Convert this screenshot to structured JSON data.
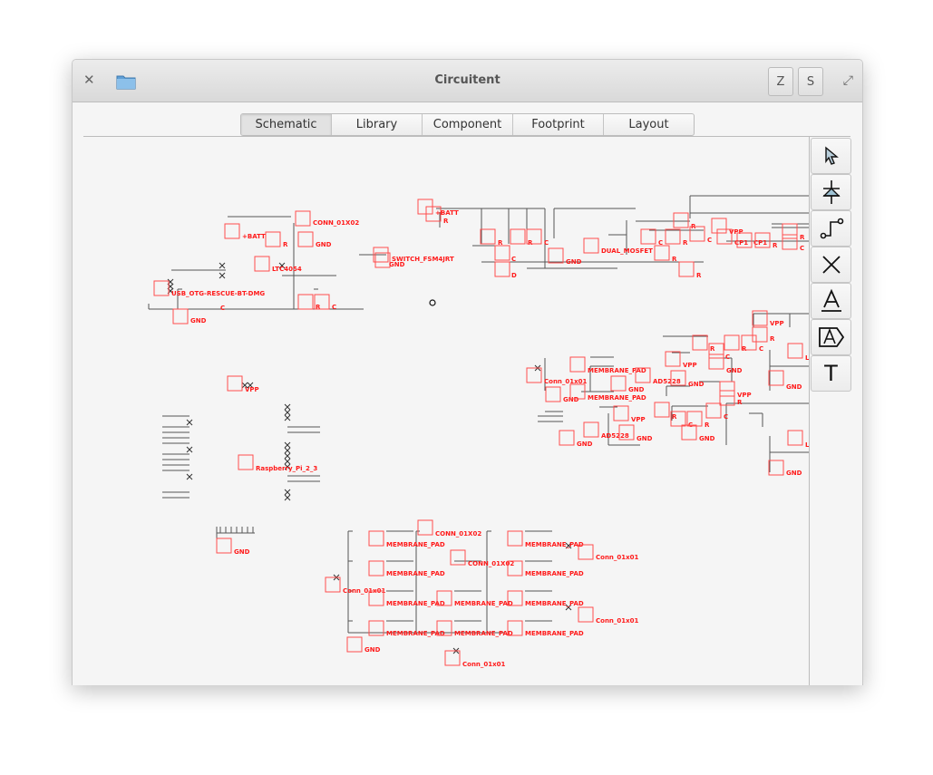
{
  "window": {
    "title": "Circuitent",
    "buttons": {
      "z": "Z",
      "s": "S"
    }
  },
  "tabs": [
    {
      "label": "Schematic",
      "active": true
    },
    {
      "label": "Library"
    },
    {
      "label": "Component"
    },
    {
      "label": "Footprint"
    },
    {
      "label": "Layout"
    }
  ],
  "toolbar": {
    "tools": [
      {
        "icon": "pointer-arrow-icon"
      },
      {
        "icon": "diode-component-icon"
      },
      {
        "icon": "wire-icon"
      },
      {
        "icon": "no-connect-icon"
      },
      {
        "icon": "net-label-icon"
      },
      {
        "icon": "global-label-icon"
      },
      {
        "icon": "text-icon",
        "glyph": "T"
      }
    ]
  },
  "colors": {
    "component": "#ff4d4d",
    "wire": "#555555",
    "label": "#ff1a1a"
  },
  "schematic": {
    "components": [
      "+BATT",
      "CONN_01X02",
      "R",
      "GND",
      "LTC4054",
      "USB_OTG-RESCUE-BT-DMG",
      "GND",
      "C",
      "R",
      "C",
      "SWITCH_FSM4JRT",
      "GND",
      "+BATT",
      "R",
      "R",
      "C",
      "D",
      "R",
      "C",
      "GND",
      "DUAL_MOSFET",
      "C",
      "R",
      "R",
      "R",
      "C",
      "R",
      "VPP",
      "CP1",
      "CP1",
      "R",
      "R",
      "C",
      "Conn_01x01",
      "GND",
      "MEMBRANE_PAD",
      "MEMBRANE_PAD",
      "GND",
      "AD5228",
      "VPP",
      "GND",
      "R",
      "C",
      "R",
      "C",
      "GND",
      "VPP",
      "R",
      "GND",
      "L",
      "VPP",
      "AD5228",
      "GND",
      "GND",
      "R",
      "C",
      "R",
      "GND",
      "C",
      "VPP",
      "R",
      "L",
      "GND",
      "VPP",
      "Raspberry_Pi_2_3",
      "GND",
      "Conn_01x01",
      "GND",
      "MEMBRANE_PAD",
      "MEMBRANE_PAD",
      "MEMBRANE_PAD",
      "MEMBRANE_PAD",
      "CONN_01X02",
      "CONN_01X02",
      "MEMBRANE_PAD",
      "MEMBRANE_PAD",
      "MEMBRANE_PAD",
      "MEMBRANE_PAD",
      "MEMBRANE_PAD",
      "MEMBRANE_PAD",
      "Conn_01x01",
      "Conn_01x01",
      "Conn_01x01"
    ]
  }
}
